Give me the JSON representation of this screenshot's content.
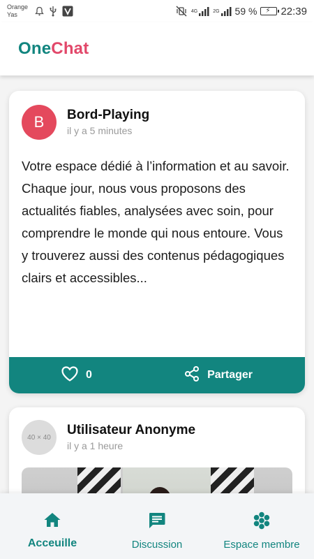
{
  "status_bar": {
    "carrier_line1": "Orange",
    "carrier_line2": "Yas",
    "network_4g": "4G",
    "network_2g": "2G",
    "battery_text": "59 %",
    "time": "22:39"
  },
  "header": {
    "logo_one": "One",
    "logo_chat": "Chat"
  },
  "posts": [
    {
      "avatar_letter": "B",
      "author": "Bord-Playing",
      "time": "il y a 5 minutes",
      "body": "Votre espace dédié à l’information et au savoir. Chaque jour, nous vous proposons des actualités fiables, analysées avec soin, pour comprendre le monde qui nous entoure. Vous y trouverez aussi des contenus pédagogiques clairs et accessibles...",
      "likes": "0",
      "share_label": "Partager"
    },
    {
      "avatar_placeholder": "40 × 40",
      "author": "Utilisateur Anonyme",
      "time": "il y a 1 heure"
    }
  ],
  "bottom_nav": {
    "home": "Acceuille",
    "discussion": "Discussion",
    "espace": "Espace membre"
  },
  "colors": {
    "brand_teal": "#12857f",
    "brand_pink": "#e2486a",
    "avatar_red": "#e4495d"
  }
}
